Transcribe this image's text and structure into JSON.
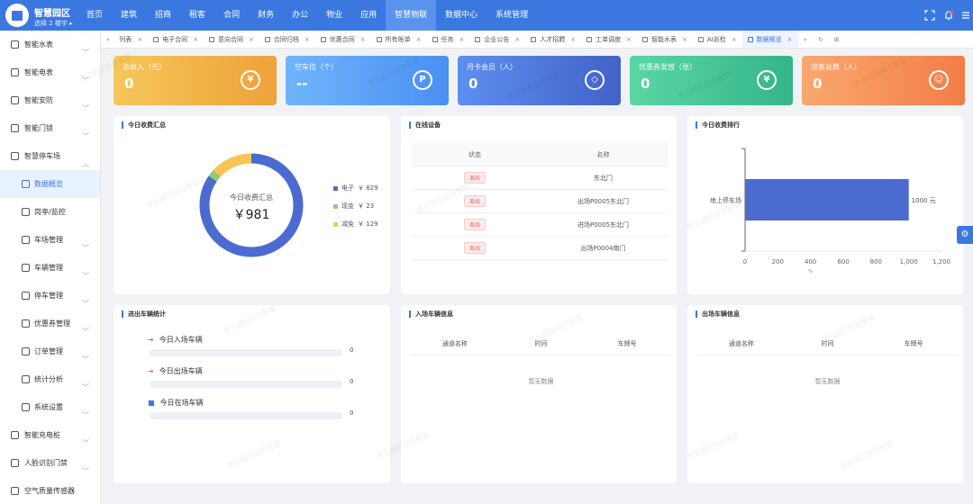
{
  "header": {
    "brand": "智慧园区",
    "building": "选择 2 楼宇 ▸",
    "nav": [
      "首页",
      "建筑",
      "招商",
      "租客",
      "合同",
      "财务",
      "办公",
      "物业",
      "应用",
      "智慧物联",
      "数据中心",
      "系统管理"
    ],
    "active_nav": "智慧物联",
    "icons": [
      "fullscreen-icon",
      "bell-icon",
      "menu-icon"
    ]
  },
  "sidebar": {
    "items": [
      {
        "label": "智能水表",
        "icon": "water-meter-icon",
        "chevron": true
      },
      {
        "label": "智能电表",
        "icon": "electric-meter-icon",
        "chevron": true
      },
      {
        "label": "智能安防",
        "icon": "camera-icon",
        "chevron": true
      },
      {
        "label": "智能门锁",
        "icon": "lock-icon",
        "chevron": true
      },
      {
        "label": "智慧停车场",
        "icon": "parking-icon",
        "chevron": true,
        "open": true
      },
      {
        "label": "数据概览",
        "icon": "dashboard-icon",
        "sub": true,
        "active": true
      },
      {
        "label": "岗亭/监控",
        "icon": "monitor-icon",
        "sub": true
      },
      {
        "label": "车场管理",
        "icon": "lot-icon",
        "sub": true,
        "chevron": true
      },
      {
        "label": "车辆管理",
        "icon": "car-icon",
        "sub": true,
        "chevron": true
      },
      {
        "label": "停车管理",
        "icon": "location-icon",
        "sub": true,
        "chevron": true
      },
      {
        "label": "优惠券管理",
        "icon": "coupon-icon",
        "sub": true,
        "chevron": true
      },
      {
        "label": "订单管理",
        "icon": "order-icon",
        "sub": true,
        "chevron": true
      },
      {
        "label": "统计分析",
        "icon": "stats-icon",
        "sub": true,
        "chevron": true
      },
      {
        "label": "系统设置",
        "icon": "settings-icon",
        "sub": true,
        "chevron": true
      },
      {
        "label": "智能充电桩",
        "icon": "charger-icon",
        "chevron": true
      },
      {
        "label": "人脸识别门禁",
        "icon": "face-icon",
        "chevron": true
      },
      {
        "label": "空气质量传感器",
        "icon": "air-icon",
        "chevron": false
      }
    ]
  },
  "tabs": {
    "items": [
      "列表",
      "电子合同",
      "意向合同",
      "合同归档",
      "优惠合同",
      "所有账单",
      "任务",
      "企业公告",
      "人才招聘",
      "工单调度",
      "智能水表",
      "AI巡检",
      "数据概览"
    ],
    "active": "数据概览"
  },
  "cards": [
    {
      "title": "总收入（元）",
      "value": "0",
      "icon": "yen-icon",
      "glyph": "¥",
      "c1": "#f6c65a",
      "c2": "#eea23a"
    },
    {
      "title": "空车位（个）",
      "value": "--",
      "icon": "parking-p-icon",
      "glyph": "P",
      "c1": "#6fb5fb",
      "c2": "#4a8ff2"
    },
    {
      "title": "月卡会员（人）",
      "value": "0",
      "icon": "diamond-icon",
      "glyph": "◇",
      "c1": "#5d8ff0",
      "c2": "#4262c8"
    },
    {
      "title": "优惠券发放（张）",
      "value": "0",
      "icon": "ticket-icon",
      "glyph": "¥",
      "c1": "#5ad6a4",
      "c2": "#34b58a"
    },
    {
      "title": "访客总数（人）",
      "value": "0",
      "icon": "user-icon",
      "glyph": "☺",
      "c1": "#f9a86f",
      "c2": "#f37d47"
    }
  ],
  "summary": {
    "title": "今日收费汇总",
    "center_label": "今日收费汇总",
    "center_value": "￥981",
    "legend": [
      {
        "label": "电子",
        "amount": "￥ 829",
        "value": 829,
        "color": "#4c6bd0"
      },
      {
        "label": "现金",
        "amount": "￥ 23",
        "value": 23,
        "color": "#91cc75"
      },
      {
        "label": "减免",
        "amount": "￥ 129",
        "value": 129,
        "color": "#f8c453"
      }
    ]
  },
  "devices": {
    "title": "在线设备",
    "columns": [
      "状态",
      "名称"
    ],
    "rows": [
      {
        "status": "离线",
        "name": "东北门"
      },
      {
        "status": "离线",
        "name": "出场P0005东北门"
      },
      {
        "status": "离线",
        "name": "进场P0005东北门"
      },
      {
        "status": "离线",
        "name": "出场P0004南门"
      }
    ]
  },
  "ranking": {
    "title": "今日收费排行"
  },
  "chart_data": {
    "type": "bar",
    "orientation": "horizontal",
    "categories": [
      "地上停车场"
    ],
    "values": [
      1000
    ],
    "data_labels": [
      "1000 元"
    ],
    "xticks": [
      "0",
      "200",
      "400",
      "600",
      "800",
      "1,000",
      "1,200"
    ],
    "xlim": [
      0,
      1200
    ],
    "xunit": "%",
    "color": "#4c6bd0"
  },
  "inout": {
    "title": "进出车辆统计",
    "items": [
      {
        "label": "今日入场车辆",
        "count": "0",
        "fraction": 0,
        "icon": "enter-icon",
        "color": "#3cba5b"
      },
      {
        "label": "今日出场车辆",
        "count": "0",
        "fraction": 0,
        "icon": "exit-icon",
        "color": "#e36c6c"
      },
      {
        "label": "今日在场车辆",
        "count": "0",
        "fraction": 0,
        "icon": "car-icon",
        "color": "#3a78e0"
      }
    ]
  },
  "entry_info": {
    "title": "入场车辆信息",
    "columns": [
      "通道名称",
      "时间",
      "车牌号"
    ],
    "empty": "暂无数据"
  },
  "exit_info": {
    "title": "出场车辆信息",
    "columns": [
      "通道名称",
      "时间",
      "车牌号"
    ],
    "empty": "暂无数据"
  },
  "watermark": "青云园区综合智管"
}
